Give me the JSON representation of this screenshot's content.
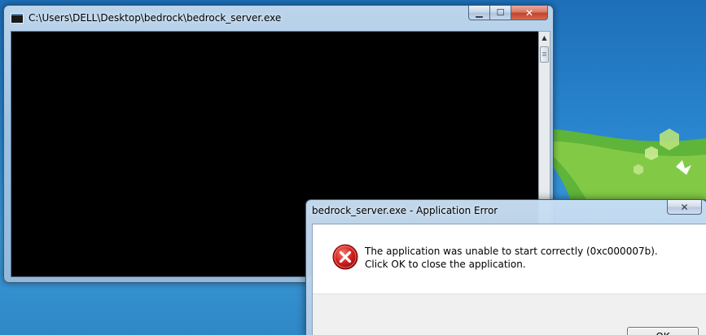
{
  "console_window": {
    "title": "C:\\Users\\DELL\\Desktop\\bedrock\\bedrock_server.exe",
    "icon": "console-app-icon",
    "buttons": {
      "minimize": "minimize-icon",
      "maximize": "maximize-icon",
      "close": "close-icon"
    }
  },
  "error_dialog": {
    "title": "bedrock_server.exe - Application Error",
    "message": "The application was unable to start correctly (0xc000007b). Click OK to close the application.",
    "icon": "error-icon",
    "ok_label": "OK"
  },
  "glyphs": {
    "minimize": "▁",
    "maximize": "☐",
    "close": "✕",
    "scroll_up": "▲"
  },
  "colors": {
    "desktop_bg": "#2a86cf",
    "console_bg": "#000000",
    "error_icon": "#d31f1f",
    "close_button": "#c2432c"
  }
}
